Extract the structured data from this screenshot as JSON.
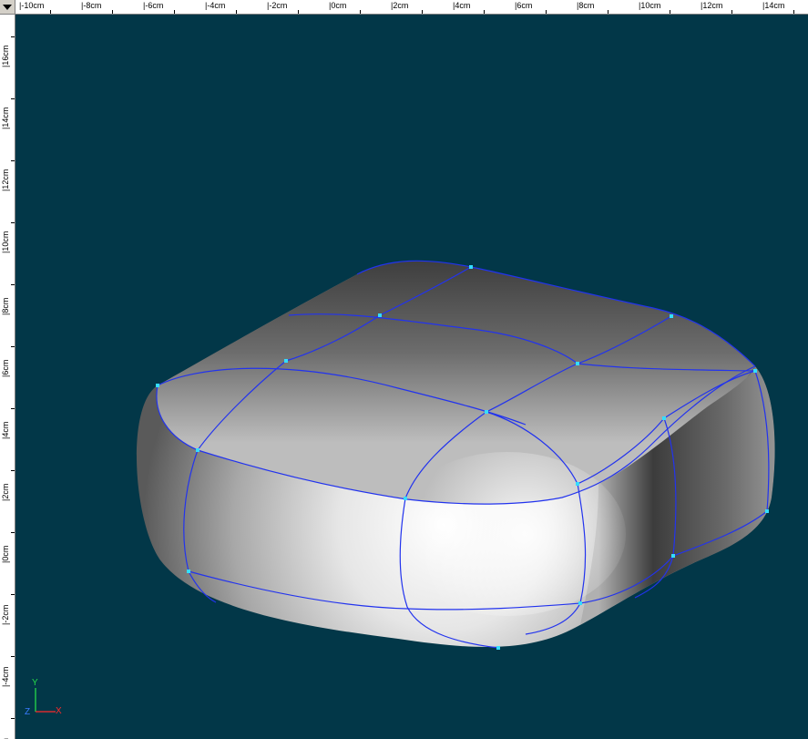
{
  "rulers": {
    "horizontal_labels": [
      "|-10cm",
      "|-8cm",
      "|-6cm",
      "|-4cm",
      "|-2cm",
      "|0cm",
      "|2cm",
      "|4cm",
      "|6cm",
      "|8cm",
      "|10cm",
      "|12cm",
      "|14cm"
    ],
    "vertical_labels": [
      "|16cm",
      "|14cm",
      "|12cm",
      "|10cm",
      "|8cm",
      "|6cm",
      "|4cm",
      "|2cm",
      "|0cm",
      "|-2cm",
      "|-4cm",
      "cm"
    ]
  },
  "axis_gizmo": {
    "y": "Y",
    "z": "Z",
    "x": "X",
    "y_color": "#26d94a",
    "z_color": "#3a7cff",
    "x_color": "#ff2a2a"
  },
  "viewport": {
    "background": "#023748",
    "curve_color": "#2233ee",
    "point_color": "#33ddff"
  },
  "corner_menu": {
    "icon": "dropdown-arrow-icon"
  }
}
